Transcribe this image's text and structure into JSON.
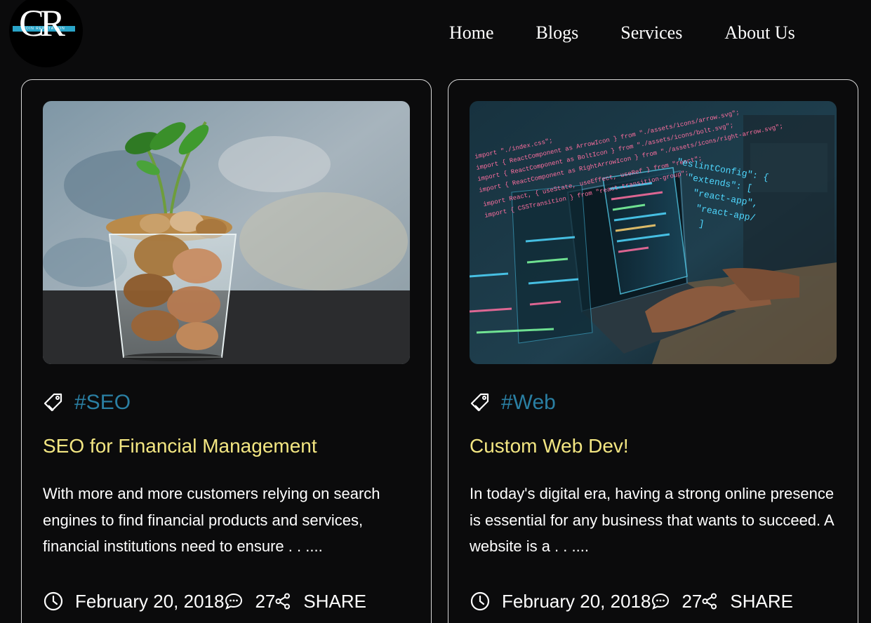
{
  "header": {
    "logo_letters": "CR",
    "logo_tagline": "COIN REPUTATION",
    "nav": [
      {
        "label": "Home"
      },
      {
        "label": "Blogs"
      },
      {
        "label": "Services"
      },
      {
        "label": "About Us"
      }
    ]
  },
  "cards": [
    {
      "image_alt": "coins in glass with plant",
      "tag": "#SEO",
      "title": "SEO for Financial Management",
      "excerpt": "With more and more customers relying on search engines to find financial products and services, financial institutions need to ensure . . ....",
      "date": "February 20, 2018",
      "comments": "27",
      "share_label": "SHARE"
    },
    {
      "image_alt": "code on laptop screen",
      "tag": "#Web",
      "title": "Custom Web Dev!",
      "excerpt": "In today's digital era, having a strong online presence is essential for any business that wants to succeed. A website is a . . ....",
      "date": "February 20, 2018",
      "comments": "27",
      "share_label": "SHARE"
    }
  ],
  "colors": {
    "background": "#0b0b0c",
    "tag": "#2a7fa3",
    "title": "#f3e682",
    "logo_band": "#2aa4c8"
  },
  "icons": [
    "tag-icon",
    "clock-icon",
    "chat-icon",
    "share-icon"
  ]
}
